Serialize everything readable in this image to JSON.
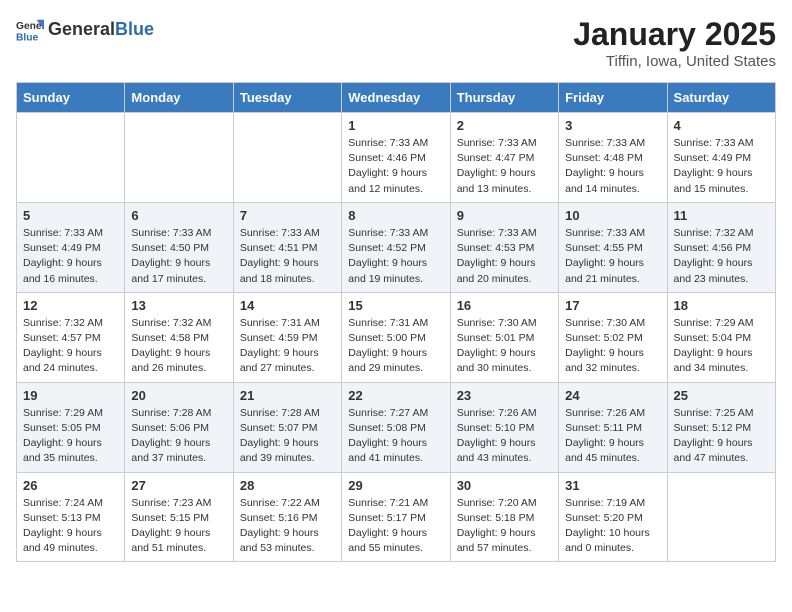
{
  "header": {
    "logo_general": "General",
    "logo_blue": "Blue",
    "month_title": "January 2025",
    "location": "Tiffin, Iowa, United States"
  },
  "days_of_week": [
    "Sunday",
    "Monday",
    "Tuesday",
    "Wednesday",
    "Thursday",
    "Friday",
    "Saturday"
  ],
  "weeks": [
    {
      "row_class": "row-odd",
      "days": [
        {
          "num": "",
          "info": ""
        },
        {
          "num": "",
          "info": ""
        },
        {
          "num": "",
          "info": ""
        },
        {
          "num": "1",
          "info": "Sunrise: 7:33 AM\nSunset: 4:46 PM\nDaylight: 9 hours\nand 12 minutes."
        },
        {
          "num": "2",
          "info": "Sunrise: 7:33 AM\nSunset: 4:47 PM\nDaylight: 9 hours\nand 13 minutes."
        },
        {
          "num": "3",
          "info": "Sunrise: 7:33 AM\nSunset: 4:48 PM\nDaylight: 9 hours\nand 14 minutes."
        },
        {
          "num": "4",
          "info": "Sunrise: 7:33 AM\nSunset: 4:49 PM\nDaylight: 9 hours\nand 15 minutes."
        }
      ]
    },
    {
      "row_class": "row-even",
      "days": [
        {
          "num": "5",
          "info": "Sunrise: 7:33 AM\nSunset: 4:49 PM\nDaylight: 9 hours\nand 16 minutes."
        },
        {
          "num": "6",
          "info": "Sunrise: 7:33 AM\nSunset: 4:50 PM\nDaylight: 9 hours\nand 17 minutes."
        },
        {
          "num": "7",
          "info": "Sunrise: 7:33 AM\nSunset: 4:51 PM\nDaylight: 9 hours\nand 18 minutes."
        },
        {
          "num": "8",
          "info": "Sunrise: 7:33 AM\nSunset: 4:52 PM\nDaylight: 9 hours\nand 19 minutes."
        },
        {
          "num": "9",
          "info": "Sunrise: 7:33 AM\nSunset: 4:53 PM\nDaylight: 9 hours\nand 20 minutes."
        },
        {
          "num": "10",
          "info": "Sunrise: 7:33 AM\nSunset: 4:55 PM\nDaylight: 9 hours\nand 21 minutes."
        },
        {
          "num": "11",
          "info": "Sunrise: 7:32 AM\nSunset: 4:56 PM\nDaylight: 9 hours\nand 23 minutes."
        }
      ]
    },
    {
      "row_class": "row-odd",
      "days": [
        {
          "num": "12",
          "info": "Sunrise: 7:32 AM\nSunset: 4:57 PM\nDaylight: 9 hours\nand 24 minutes."
        },
        {
          "num": "13",
          "info": "Sunrise: 7:32 AM\nSunset: 4:58 PM\nDaylight: 9 hours\nand 26 minutes."
        },
        {
          "num": "14",
          "info": "Sunrise: 7:31 AM\nSunset: 4:59 PM\nDaylight: 9 hours\nand 27 minutes."
        },
        {
          "num": "15",
          "info": "Sunrise: 7:31 AM\nSunset: 5:00 PM\nDaylight: 9 hours\nand 29 minutes."
        },
        {
          "num": "16",
          "info": "Sunrise: 7:30 AM\nSunset: 5:01 PM\nDaylight: 9 hours\nand 30 minutes."
        },
        {
          "num": "17",
          "info": "Sunrise: 7:30 AM\nSunset: 5:02 PM\nDaylight: 9 hours\nand 32 minutes."
        },
        {
          "num": "18",
          "info": "Sunrise: 7:29 AM\nSunset: 5:04 PM\nDaylight: 9 hours\nand 34 minutes."
        }
      ]
    },
    {
      "row_class": "row-even",
      "days": [
        {
          "num": "19",
          "info": "Sunrise: 7:29 AM\nSunset: 5:05 PM\nDaylight: 9 hours\nand 35 minutes."
        },
        {
          "num": "20",
          "info": "Sunrise: 7:28 AM\nSunset: 5:06 PM\nDaylight: 9 hours\nand 37 minutes."
        },
        {
          "num": "21",
          "info": "Sunrise: 7:28 AM\nSunset: 5:07 PM\nDaylight: 9 hours\nand 39 minutes."
        },
        {
          "num": "22",
          "info": "Sunrise: 7:27 AM\nSunset: 5:08 PM\nDaylight: 9 hours\nand 41 minutes."
        },
        {
          "num": "23",
          "info": "Sunrise: 7:26 AM\nSunset: 5:10 PM\nDaylight: 9 hours\nand 43 minutes."
        },
        {
          "num": "24",
          "info": "Sunrise: 7:26 AM\nSunset: 5:11 PM\nDaylight: 9 hours\nand 45 minutes."
        },
        {
          "num": "25",
          "info": "Sunrise: 7:25 AM\nSunset: 5:12 PM\nDaylight: 9 hours\nand 47 minutes."
        }
      ]
    },
    {
      "row_class": "row-odd",
      "days": [
        {
          "num": "26",
          "info": "Sunrise: 7:24 AM\nSunset: 5:13 PM\nDaylight: 9 hours\nand 49 minutes."
        },
        {
          "num": "27",
          "info": "Sunrise: 7:23 AM\nSunset: 5:15 PM\nDaylight: 9 hours\nand 51 minutes."
        },
        {
          "num": "28",
          "info": "Sunrise: 7:22 AM\nSunset: 5:16 PM\nDaylight: 9 hours\nand 53 minutes."
        },
        {
          "num": "29",
          "info": "Sunrise: 7:21 AM\nSunset: 5:17 PM\nDaylight: 9 hours\nand 55 minutes."
        },
        {
          "num": "30",
          "info": "Sunrise: 7:20 AM\nSunset: 5:18 PM\nDaylight: 9 hours\nand 57 minutes."
        },
        {
          "num": "31",
          "info": "Sunrise: 7:19 AM\nSunset: 5:20 PM\nDaylight: 10 hours\nand 0 minutes."
        },
        {
          "num": "",
          "info": ""
        }
      ]
    }
  ]
}
